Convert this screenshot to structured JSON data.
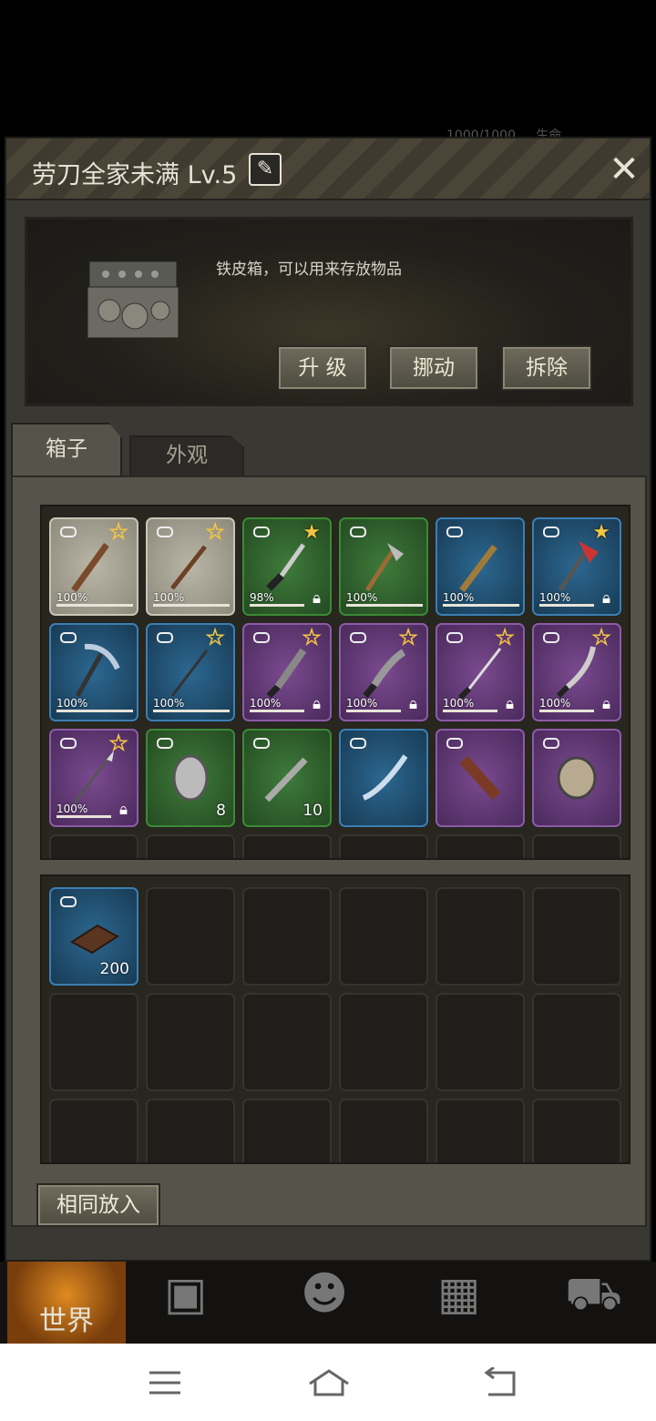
{
  "window": {
    "title": "劳刀全家未满 Lv.5",
    "edit_icon": "pencil-icon",
    "close_label": "✕"
  },
  "status_ghost": "1000/1000 ... 生命",
  "info": {
    "description": "铁皮箱，可以用来存放物品",
    "buttons": [
      "升 级",
      "挪动",
      "拆除"
    ]
  },
  "tabs": [
    "箱子",
    "外观"
  ],
  "box_items": [
    {
      "rarity": "gray",
      "star": "empty",
      "durability": "100%",
      "lock": false,
      "icon": "wooden-club-icon"
    },
    {
      "rarity": "gray",
      "star": "empty",
      "durability": "100%",
      "lock": false,
      "icon": "wooden-stick-icon"
    },
    {
      "rarity": "green",
      "star": "full",
      "durability": "98%",
      "lock": true,
      "icon": "knife-icon"
    },
    {
      "rarity": "green",
      "star": "none",
      "durability": "100%",
      "lock": false,
      "icon": "axe-icon"
    },
    {
      "rarity": "blue",
      "star": "none",
      "durability": "100%",
      "lock": false,
      "icon": "spiked-bat-icon"
    },
    {
      "rarity": "blue",
      "star": "full",
      "durability": "100%",
      "lock": true,
      "icon": "fire-axe-icon"
    },
    {
      "rarity": "blue",
      "star": "none",
      "durability": "100%",
      "lock": false,
      "icon": "pickaxe-icon"
    },
    {
      "rarity": "blue",
      "star": "empty",
      "durability": "100%",
      "lock": false,
      "icon": "rod-icon"
    },
    {
      "rarity": "purple",
      "star": "empty",
      "durability": "100%",
      "lock": true,
      "icon": "serrated-blade-icon"
    },
    {
      "rarity": "purple",
      "star": "empty",
      "durability": "100%",
      "lock": true,
      "icon": "kukri-icon"
    },
    {
      "rarity": "purple",
      "star": "empty",
      "durability": "100%",
      "lock": true,
      "icon": "katana-icon"
    },
    {
      "rarity": "purple",
      "star": "empty",
      "durability": "100%",
      "lock": true,
      "icon": "scimitar-icon"
    },
    {
      "rarity": "purple",
      "star": "empty",
      "durability": "100%",
      "lock": true,
      "icon": "spear-icon"
    },
    {
      "rarity": "green",
      "star": "none",
      "count": "8",
      "icon": "metal-plate-icon"
    },
    {
      "rarity": "green",
      "star": "none",
      "count": "10",
      "icon": "blade-part-icon"
    },
    {
      "rarity": "blue",
      "star": "none",
      "icon": "long-blade-icon"
    },
    {
      "rarity": "purple",
      "star": "none",
      "icon": "handle-icon"
    },
    {
      "rarity": "purple",
      "star": "none",
      "icon": "metal-lump-icon"
    }
  ],
  "bag_items": [
    {
      "rarity": "blue",
      "count": "200",
      "icon": "chocolate-bar-icon"
    }
  ],
  "same_button": "相同放入",
  "nav": {
    "world": "世界",
    "icons": [
      "backpack-icon",
      "head-gear-icon",
      "building-icon",
      "cart-icon"
    ]
  }
}
